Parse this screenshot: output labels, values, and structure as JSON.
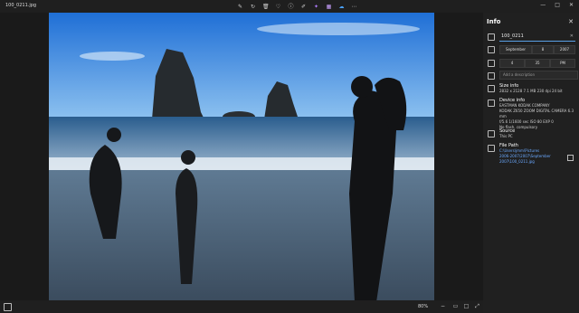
{
  "window": {
    "title": "100_0211.jpg"
  },
  "toolbar": {
    "icons": [
      "edit-icon",
      "rotate-icon",
      "delete-icon",
      "favorite-icon",
      "info-icon",
      "draw-icon",
      "ai-icon",
      "apps-icon",
      "onedrive-icon",
      "more-icon"
    ]
  },
  "window_controls": {
    "minimize": "—",
    "maximize": "□",
    "close": "✕"
  },
  "bottom": {
    "zoom": "80%"
  },
  "panel": {
    "title": "Info",
    "file_name": "100_0211",
    "date": {
      "month": "September",
      "day": "8",
      "year": "2007"
    },
    "time": {
      "hour": "4",
      "minute": "35",
      "ampm": "PM"
    },
    "description_placeholder": "Add a description",
    "size_info": {
      "heading": "Size info",
      "details": "2832 x 2128   7.1 MB   230 dpi   24 bit"
    },
    "device_info": {
      "heading": "Device info",
      "line1": "EASTMAN KODAK COMPANY",
      "line2": "KODAK Z650 ZOOM DIGITAL CAMERA   6.3 mm",
      "line3": "f/5.6   1/1600 sec   ISO 80   EXP 0",
      "line4": "No flash, compulsory"
    },
    "source": {
      "heading": "Source",
      "value": "This PC"
    },
    "file_path": {
      "heading": "File Path",
      "line1": "C:\\Users\\jmm\\Pictures",
      "line2": "2006-2007\\2007\\September",
      "line3": "2007\\100_0211.jpg"
    }
  },
  "colors": {
    "accent": "#5aa0e6",
    "link": "#6aa9ff"
  }
}
